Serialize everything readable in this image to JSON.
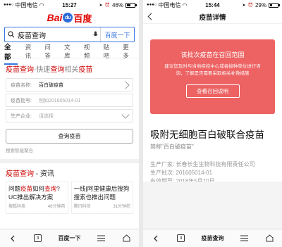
{
  "left": {
    "status": {
      "carrier": "中国电信",
      "time": "15:27",
      "battery": "46%",
      "battery_fill": 0.46
    },
    "logo": {
      "bai": "Bai",
      "du": "百度"
    },
    "search": {
      "query": "疫苗查询",
      "button": "百度一下"
    },
    "tabs": [
      "全部",
      "资讯",
      "问答",
      "文库",
      "视频",
      "贴吧",
      "更多"
    ],
    "card": {
      "title_a": "疫苗查询",
      "title_b": "-快速",
      "title_c": "查询",
      "title_d": "相关",
      "title_e": "疫苗",
      "rows": [
        {
          "label": "疫苗名称:",
          "value": "百白破疫苗"
        },
        {
          "label": "疫苗批号:",
          "placeholder": "例如201605014-01"
        },
        {
          "label": "生产企业:",
          "placeholder": "请选择"
        }
      ],
      "query_button": "查询疫苗",
      "source": "搜索智能聚合"
    },
    "news": {
      "title_a": "疫苗查询",
      "title_b": " - 资讯",
      "items": [
        {
          "t1": "问题",
          "t2": "疫苗",
          "t3": "如何",
          "t4": "查询",
          "t5": "?UC推出解决方案",
          "source": "搜狐科技",
          "time": "46分钟前"
        },
        {
          "t1": "一线|阿里健康后搜狗搜索也推出问题",
          "source": "腾讯科技",
          "time": "31分钟前"
        }
      ]
    },
    "bottom": {
      "tab_count": "3",
      "title": "百度一下"
    }
  },
  "right": {
    "status": {
      "carrier": "中国电信",
      "time": "15:44",
      "battery": "29%",
      "battery_fill": 0.29
    },
    "header_title": "疫苗详情",
    "recall": {
      "heading": "该批次疫苗在召回范围",
      "desc": "建议您及时与当地疾控中心或者接种单位进行咨询，了解是否需要采取相关补救措施",
      "button": "查看召回说明"
    },
    "vaccine": {
      "name": "吸附无细胞百白破联合疫苗",
      "alias": "简称\"百白破疫苗\"",
      "manufacturer_label": "生产厂家:",
      "manufacturer": "长春长生生物科技有限责任公司",
      "batch_label": "生产批次:",
      "batch": "201605014-01",
      "expiry_label": "有效期至:",
      "expiry": "2018年5月10日"
    },
    "bottom": {
      "tab_count": "3",
      "title": "疫苗查询"
    }
  }
}
